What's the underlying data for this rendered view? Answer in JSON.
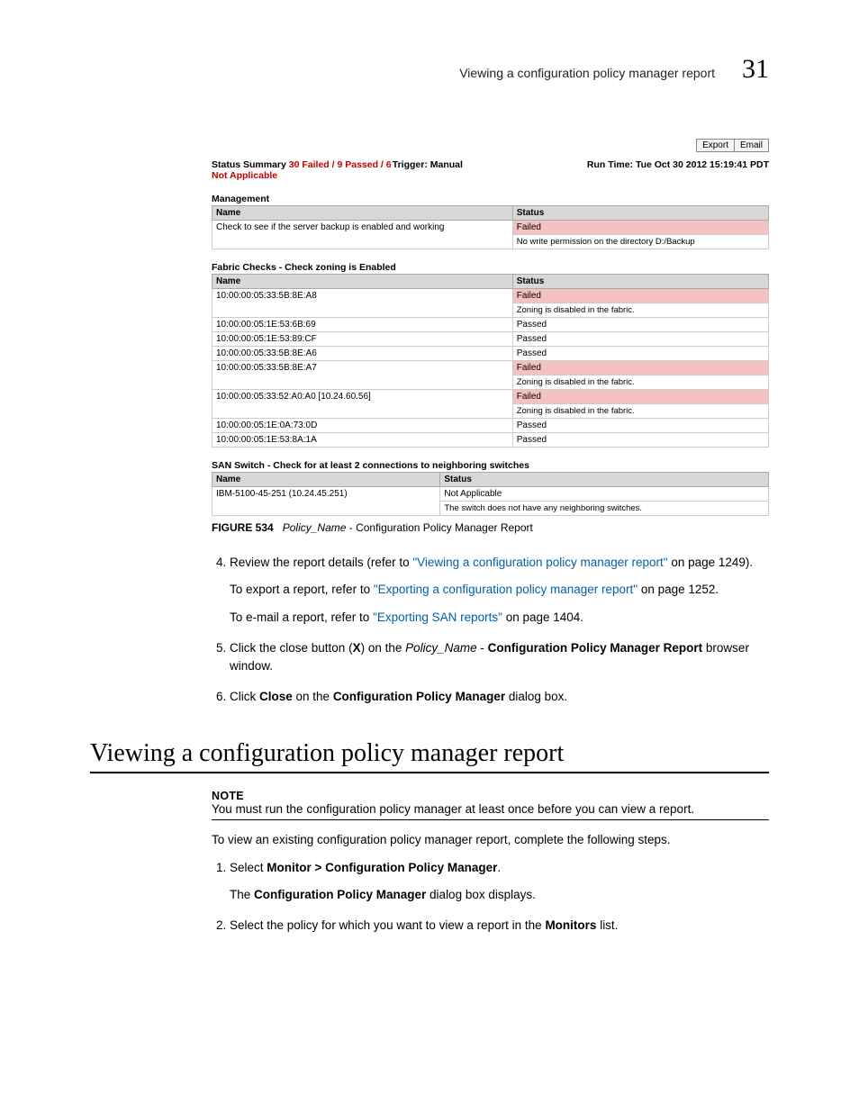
{
  "header": {
    "running_title": "Viewing a configuration policy manager report",
    "chapter_number": "31"
  },
  "report": {
    "buttons": {
      "export": "Export",
      "email": "Email"
    },
    "summary": {
      "prefix": "Status Summary ",
      "counts": "30 Failed / 9 Passed / 6 Not Applicable",
      "trigger_label": "Trigger: Manual",
      "runtime_label": "Run Time: Tue Oct 30 2012 15:19:41 PDT"
    },
    "col_name": "Name",
    "col_status": "Status",
    "sections": {
      "management": {
        "title": "Management",
        "row_name": "Check to see if the server backup is enabled and working",
        "row_status": "Failed",
        "row_detail": "No write permission on the directory D:/Backup"
      },
      "fabric": {
        "title": "Fabric Checks - Check zoning is Enabled",
        "rows": [
          {
            "name": "10:00:00:05:33:5B:8E:A8",
            "status": "Failed",
            "detail": "Zoning is disabled in the fabric."
          },
          {
            "name": "10:00:00:05:1E:53:6B:69",
            "status": "Passed"
          },
          {
            "name": "10:00:00:05:1E:53:89:CF",
            "status": "Passed"
          },
          {
            "name": "10:00:00:05:33:5B:8E:A6",
            "status": "Passed"
          },
          {
            "name": "10:00:00:05:33:5B:8E:A7",
            "status": "Failed",
            "detail": "Zoning is disabled in the fabric."
          },
          {
            "name": "10:00:00:05:33:52:A0:A0 [10.24.60.56]",
            "status": "Failed",
            "detail": "Zoning is disabled in the fabric."
          },
          {
            "name": "10:00:00:05:1E:0A:73:0D",
            "status": "Passed"
          },
          {
            "name": "10:00:00:05:1E:53:8A:1A",
            "status": "Passed"
          }
        ]
      },
      "san": {
        "title": "SAN Switch - Check for at least 2 connections to neighboring switches",
        "row_name": "IBM-5100-45-251 (10.24.45.251)",
        "row_status": "Not Applicable",
        "row_detail": "The switch does not have any neighboring switches."
      }
    }
  },
  "figure": {
    "label": "FIGURE 534",
    "name_italic": "Policy_Name",
    "suffix": " - Configuration Policy Manager Report"
  },
  "steps_a": {
    "s4": {
      "pre": "Review the report details (refer to ",
      "link": "\"Viewing a configuration policy manager report\"",
      "post": " on page 1249).",
      "p2_pre": "To export a report, refer to ",
      "p2_link": "\"Exporting a configuration policy manager report\"",
      "p2_post": " on page 1252.",
      "p3_pre": "To e-mail a report, refer to ",
      "p3_link": "\"Exporting SAN reports\"",
      "p3_post": " on page 1404."
    },
    "s5": {
      "t1": "Click the close button (",
      "x": "X",
      "t2": ") on the ",
      "ital": "Policy_Name",
      "t3": " - ",
      "bold": "Configuration Policy Manager Report",
      "t4": " browser window."
    },
    "s6": {
      "t1": "Click ",
      "b1": "Close",
      "t2": " on the ",
      "b2": "Configuration Policy Manager",
      "t3": " dialog box."
    }
  },
  "h1": "Viewing a configuration policy manager report",
  "note": {
    "hdr": "NOTE",
    "body": "You must run the configuration policy manager at least once before you can view a report."
  },
  "intro": "To view an existing configuration policy manager report, complete the following steps.",
  "steps_b": {
    "s1": {
      "t1": "Select ",
      "b1": "Monitor > Configuration Policy Manager",
      "t2": ".",
      "p2a": "The ",
      "p2b": "Configuration Policy Manager",
      "p2c": " dialog box displays."
    },
    "s2": {
      "t1": "Select the policy for which you want to view a report in the ",
      "b1": "Monitors",
      "t2": " list."
    }
  }
}
